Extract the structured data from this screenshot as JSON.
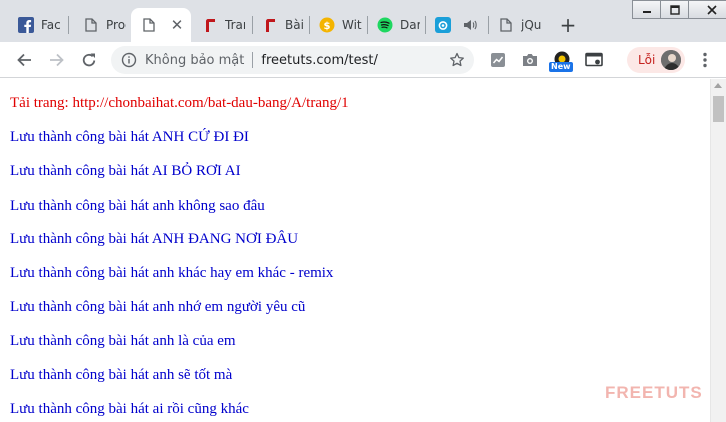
{
  "tabs": [
    {
      "title": "Face",
      "icon": "facebook-icon",
      "active": false
    },
    {
      "title": "Prog",
      "icon": "page-icon",
      "active": false
    },
    {
      "title": "",
      "icon": "page-icon",
      "active": true
    },
    {
      "title": "Trang",
      "icon": "red-flag-icon",
      "active": false
    },
    {
      "title": "Bài",
      "icon": "red-flag-icon",
      "active": false
    },
    {
      "title": "Wit",
      "icon": "coin-icon",
      "active": false
    },
    {
      "title": "Dar",
      "icon": "music-icon",
      "active": false
    },
    {
      "title": "",
      "icon": "camera-app-icon",
      "active": false
    },
    {
      "title": "jQu",
      "icon": "page-icon",
      "active": false
    }
  ],
  "colors": {
    "tabstrip": "#dee1e6",
    "link_blue": "#0000cc",
    "header_red": "#e00000",
    "profile_bg": "#fce8e6",
    "watermark": "#e7786e"
  },
  "toolbar": {
    "security_text": "Không bảo mật",
    "url": "freetuts.com/test/",
    "extension_badge": "New",
    "profile_label": "Lỗi"
  },
  "page": {
    "header": "Tải trang: http://chonbaihat.com/bat-dau-bang/A/trang/1",
    "lines": [
      "Lưu thành công bài hát ANH CỨ ĐI ĐI",
      "Lưu thành công bài hát AI BỎ RƠI AI",
      "Lưu thành công bài hát anh không sao đâu",
      "Lưu thành công bài hát ANH ĐANG NƠI ĐÂU",
      "Lưu thành công bài hát anh khác hay em khác - remix",
      "Lưu thành công bài hát anh nhớ em người yêu cũ",
      "Lưu thành công bài hát anh là của em",
      "Lưu thành công bài hát anh sẽ tốt mà",
      "Lưu thành công bài hát ai rồi cũng khác"
    ]
  },
  "watermark": "FREETUTS"
}
